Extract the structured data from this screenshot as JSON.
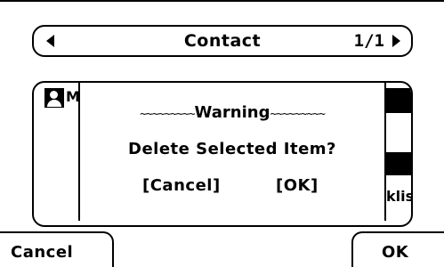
{
  "header": {
    "title": "Contact",
    "page_indicator": "1/1",
    "left_arrow_icon": "left-arrow-icon",
    "right_arrow_icon": "right-arrow-icon"
  },
  "list": {
    "partial_item_text": "M",
    "right_partial_text": "klis",
    "contact_icon": "contact-person-icon"
  },
  "dialog": {
    "tilde_left": "~~~~~~~~~",
    "title": "Warning",
    "tilde_right": "~~~~~~~~~",
    "message": "Delete Selected Item?",
    "cancel_label": "[Cancel]",
    "ok_label": "[OK]"
  },
  "softkeys": {
    "left_label": "Cancel",
    "right_label": "OK"
  }
}
